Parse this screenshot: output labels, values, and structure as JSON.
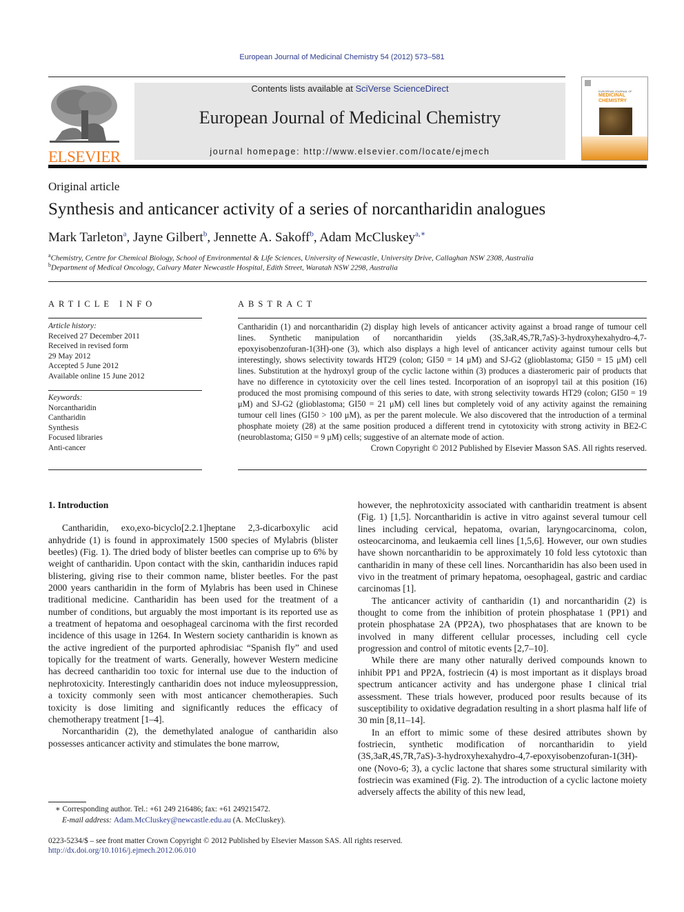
{
  "running_head": "European Journal of Medicinal Chemistry 54 (2012) 573–581",
  "banner": {
    "contents_prefix": "Contents lists available at ",
    "contents_link": "SciVerse ScienceDirect",
    "journal_name": "European Journal of Medicinal Chemistry",
    "homepage": "journal homepage: http://www.elsevier.com/locate/ejmech"
  },
  "logo": {
    "publisher": "ELSEVIER",
    "icon": "tree-logo-icon",
    "color": "#f47b20"
  },
  "cover": {
    "line1": "EUROPEAN JOURNAL OF",
    "line2": "MEDICINAL",
    "line3": "CHEMISTRY",
    "accent": "#e8901a"
  },
  "article_type": "Original article",
  "title": "Synthesis and anticancer activity of a series of norcantharidin analogues",
  "authors": [
    {
      "name": "Mark Tarleton",
      "sup": "a",
      "sep": ", "
    },
    {
      "name": "Jayne Gilbert",
      "sup": "b",
      "sep": ", "
    },
    {
      "name": "Jennette A. Sakoff",
      "sup": "b",
      "sep": ", "
    },
    {
      "name": "Adam McCluskey",
      "sup": "a,∗",
      "sep": ""
    }
  ],
  "affiliations": [
    {
      "mark": "a",
      "text": "Chemistry, Centre for Chemical Biology, School of Environmental & Life Sciences, University of Newcastle, University Drive, Callaghan NSW 2308, Australia"
    },
    {
      "mark": "b",
      "text": "Department of Medical Oncology, Calvary Mater Newcastle Hospital, Edith Street, Waratah NSW 2298, Australia"
    }
  ],
  "article_info": {
    "heading": "ARTICLE INFO",
    "history_label": "Article history:",
    "history": [
      "Received 27 December 2011",
      "Received in revised form",
      "29 May 2012",
      "Accepted 5 June 2012",
      "Available online 15 June 2012"
    ],
    "keywords_label": "Keywords:",
    "keywords": [
      "Norcantharidin",
      "Cantharidin",
      "Synthesis",
      "Focused libraries",
      "Anti-cancer"
    ]
  },
  "abstract": {
    "heading": "ABSTRACT",
    "text": "Cantharidin (1) and norcantharidin (2) display high levels of anticancer activity against a broad range of tumour cell lines. Synthetic manipulation of norcantharidin yields (3S,3aR,4S,7R,7aS)-3-hydroxyhexahydro-4,7-epoxyisobenzofuran-1(3H)-one (3), which also displays a high level of anticancer activity against tumour cells but interestingly, shows selectivity towards HT29 (colon; GI50 = 14 μM) and SJ-G2 (glioblastoma; GI50 = 15 μM) cell lines. Substitution at the hydroxyl group of the cyclic lactone within (3) produces a diasteromeric pair of products that have no difference in cytotoxicity over the cell lines tested. Incorporation of an isopropyl tail at this position (16) produced the most promising compound of this series to date, with strong selectivity towards HT29 (colon; GI50 = 19 μM) and SJ-G2 (glioblastoma; GI50 = 21 μM) cell lines but completely void of any activity against the remaining tumour cell lines (GI50 > 100 μM), as per the parent molecule. We also discovered that the introduction of a terminal phosphate moiety (28) at the same position produced a different trend in cytotoxicity with strong activity in BE2-C (neuroblastoma; GI50 = 9 μM) cells; suggestive of an alternate mode of action.",
    "copyright": "Crown Copyright © 2012 Published by Elsevier Masson SAS. All rights reserved."
  },
  "body": {
    "section_title": "1.  Introduction",
    "left_paragraphs": [
      "Cantharidin, exo,exo-bicyclo[2.2.1]heptane 2,3-dicarboxylic acid anhydride (1) is found in approximately 1500 species of Mylabris (blister beetles) (Fig. 1). The dried body of blister beetles can comprise up to 6% by weight of cantharidin. Upon contact with the skin, cantharidin induces rapid blistering, giving rise to their common name, blister beetles. For the past 2000 years cantharidin in the form of Mylabris has been used in Chinese traditional medicine. Cantharidin has been used for the treatment of a number of conditions, but arguably the most important is its reported use as a treatment of hepatoma and oesophageal carcinoma with the first recorded incidence of this usage in 1264. In Western society cantharidin is known as the active ingredient of the purported aphrodisiac “Spanish fly” and used topically for the treatment of warts. Generally, however Western medicine has decreed cantharidin too toxic for internal use due to the induction of nephrotoxicity. Interestingly cantharidin does not induce myleosuppression, a toxicity commonly seen with most anticancer chemotherapies. Such toxicity is dose limiting and significantly reduces the efficacy of chemotherapy treatment [1–4].",
      "Norcantharidin (2), the demethylated analogue of cantharidin also possesses anticancer activity and stimulates the bone marrow,"
    ],
    "right_paragraphs": [
      "however, the nephrotoxicity associated with cantharidin treatment is absent (Fig. 1) [1,5]. Norcantharidin is active in vitro against several tumour cell lines including cervical, hepatoma, ovarian, laryngocarcinoma, colon, osteocarcinoma, and leukaemia cell lines [1,5,6]. However, our own studies have shown norcantharidin to be approximately 10 fold less cytotoxic than cantharidin in many of these cell lines. Norcantharidin has also been used in vivo in the treatment of primary hepatoma, oesophageal, gastric and cardiac carcinomas [1].",
      "The anticancer activity of cantharidin (1) and norcantharidin (2) is thought to come from the inhibition of protein phosphatase 1 (PP1) and protein phosphatase 2A (PP2A), two phosphatases that are known to be involved in many different cellular processes, including cell cycle progression and control of mitotic events [2,7–10].",
      "While there are many other naturally derived compounds known to inhibit PP1 and PP2A, fostriecin (4) is most important as it displays broad spectrum anticancer activity and has undergone phase I clinical trial assessment. These trials however, produced poor results because of its susceptibility to oxidative degradation resulting in a short plasma half life of 30 min [8,11–14].",
      "In an effort to mimic some of these desired attributes shown by fostriecin, synthetic modification of norcantharidin to yield (3S,3aR,4S,7R,7aS)-3-hydroxyhexahydro-4,7-epoxyisobenzofuran-1(3H)-one (Novo-6; 3), a cyclic lactone that shares some structural similarity with fostriecin was examined (Fig. 2). The introduction of a cyclic lactone moiety adversely affects the ability of this new lead,"
    ]
  },
  "footnote": {
    "star": "∗",
    "corresponding": "Corresponding author. Tel.: +61 249 216486; fax: +61 249215472.",
    "email_label": "E-mail address: ",
    "email": "Adam.McCluskey@newcastle.edu.au",
    "email_suffix": " (A. McCluskey)."
  },
  "footer": {
    "issn_line": "0223-5234/$ – see front matter Crown Copyright © 2012 Published by Elsevier Masson SAS. All rights reserved.",
    "doi": "http://dx.doi.org/10.1016/j.ejmech.2012.06.010"
  }
}
